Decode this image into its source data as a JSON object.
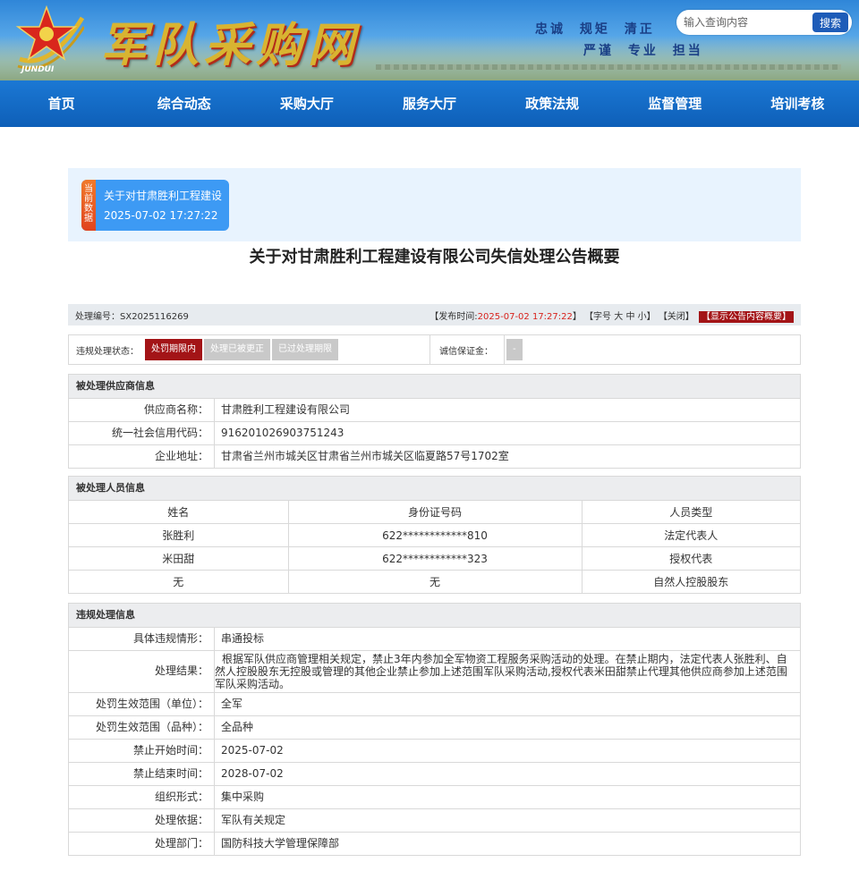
{
  "header": {
    "site_title": "军队采购网",
    "logo_text": "JUNDUI",
    "motto_line1": "忠诚 规矩 清正",
    "motto_line2": "严谨 专业 担当",
    "search": {
      "placeholder": "输入查询内容",
      "button": "搜索"
    },
    "colors": {
      "nav": "#1b78d4",
      "accent_red": "#a31417",
      "panel": "#e8f3fe",
      "card": "#3d9af4"
    }
  },
  "nav": {
    "items": [
      "首页",
      "综合动态",
      "采购大厅",
      "服务大厅",
      "政策法规",
      "监督管理",
      "培训考核"
    ]
  },
  "current": {
    "tag": "当前数据",
    "title": "关于对甘肃胜利工程建设",
    "time": "2025-07-02 17:27:22"
  },
  "page_title": "关于对甘肃胜利工程建设有限公司失信处理公告概要",
  "infobar": {
    "number_label": "处理编号：",
    "number": "SX2025116269",
    "publish_label": "【发布时间:",
    "publish_time": "2025-07-02 17:27:22",
    "publish_end": "】",
    "font_label": "【字号",
    "font_large": "大",
    "font_mid": "中",
    "font_small": "小】",
    "close": "【关闭】",
    "show_summary": "【显示公告内容概要】"
  },
  "status": {
    "label": "违规处理状态：",
    "tags": [
      "处罚期限内",
      "处理已被更正",
      "已过处理期限"
    ],
    "deposit_label": "诚信保证金：",
    "deposit_value": "-"
  },
  "supplier": {
    "heading": "被处理供应商信息",
    "rows": [
      {
        "k": "供应商名称：",
        "v": "甘肃胜利工程建设有限公司"
      },
      {
        "k": "统一社会信用代码：",
        "v": "916201026903751243"
      },
      {
        "k": "企业地址：",
        "v": "甘肃省兰州市城关区甘肃省兰州市城关区临夏路57号1702室"
      }
    ]
  },
  "persons": {
    "heading": "被处理人员信息",
    "columns": [
      "姓名",
      "身份证号码",
      "人员类型"
    ],
    "rows": [
      [
        "张胜利",
        "622************810",
        "法定代表人"
      ],
      [
        "米田甜",
        "622************323",
        "授权代表"
      ],
      [
        "无",
        "无",
        "自然人控股股东"
      ]
    ]
  },
  "violation": {
    "heading": "违规处理信息",
    "situation_k": "具体违规情形：",
    "situation_v": "串通投标",
    "result_k": "处理结果：",
    "result_v": "根据军队供应商管理相关规定，禁止3年内参加全军物资工程服务采购活动的处理。在禁止期内，法定代表人张胜利、自然人控股股东无控股或管理的其他企业禁止参加上述范围军队采购活动,授权代表米田甜禁止代理其他供应商参加上述范围军队采购活动。",
    "rows": [
      {
        "k": "处罚生效范围（单位）：",
        "v": "全军"
      },
      {
        "k": "处罚生效范围（品种）：",
        "v": "全品种"
      },
      {
        "k": "禁止开始时间：",
        "v": "2025-07-02"
      },
      {
        "k": "禁止结束时间：",
        "v": "2028-07-02"
      },
      {
        "k": "组织形式：",
        "v": "集中采购"
      },
      {
        "k": "处理依据：",
        "v": "军队有关规定"
      },
      {
        "k": "处理部门：",
        "v": "国防科技大学管理保障部"
      }
    ]
  }
}
